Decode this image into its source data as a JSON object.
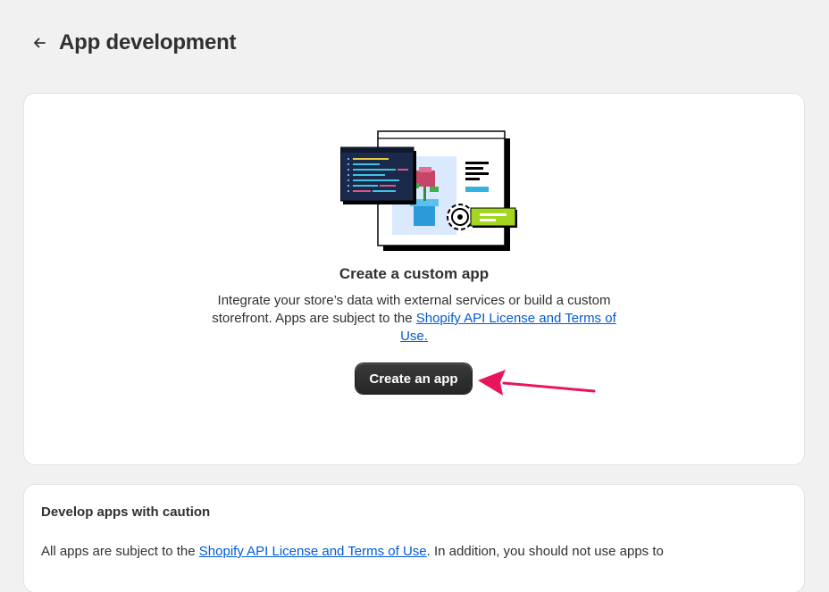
{
  "header": {
    "title": "App development",
    "back_icon": "arrow-left-icon"
  },
  "main_card": {
    "illustration": "custom-app-illustration",
    "title": "Create a custom app",
    "description_line1": "Integrate your store’s data with external services or build a custom",
    "description_line2_prefix": "storefront. Apps are subject to the ",
    "license_link": "Shopify API License and Terms of",
    "license_link_cont": "Use.",
    "create_button_label": "Create an app"
  },
  "annotation": {
    "arrow_color": "#e8155e"
  },
  "caution_card": {
    "title": "Develop apps with caution",
    "text_prefix": "All apps are subject to the ",
    "text_link": "Shopify API License and Terms of Use",
    "text_suffix": ". In addition, you should not use apps to"
  },
  "colors": {
    "background": "#f1f1f1",
    "card": "#ffffff",
    "link": "#005bd3",
    "button": "#303030"
  }
}
